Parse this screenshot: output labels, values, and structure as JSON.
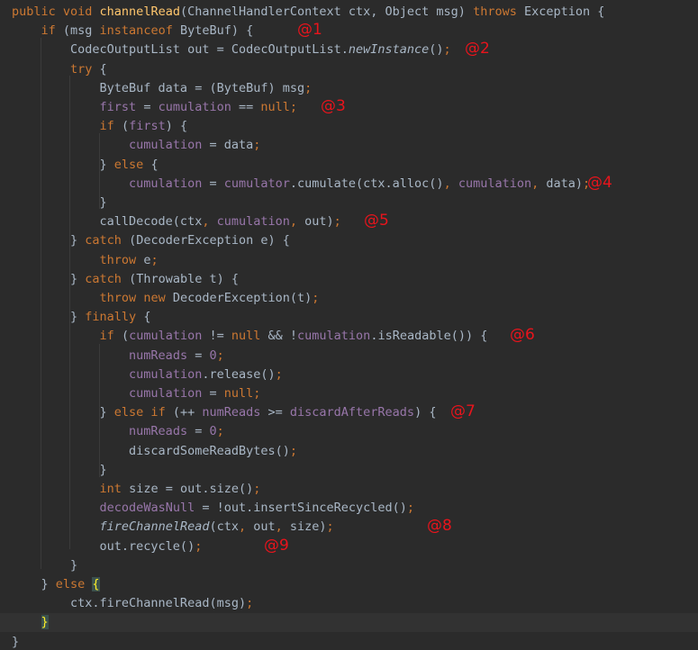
{
  "editor": {
    "lines": [
      [
        {
          "t": "public void ",
          "c": "kw"
        },
        {
          "t": "channelRead",
          "c": "fn"
        },
        {
          "t": "(ChannelHandlerContext ctx, Object msg) "
        },
        {
          "t": "throws ",
          "c": "kw"
        },
        {
          "t": "Exception {"
        }
      ],
      [
        {
          "t": "    "
        },
        {
          "t": "if ",
          "c": "kw"
        },
        {
          "t": "(msg "
        },
        {
          "t": "instanceof ",
          "c": "kw"
        },
        {
          "t": "ByteBuf) {"
        }
      ],
      [
        {
          "t": "        CodecOutputList out = CodecOutputList."
        },
        {
          "t": "newInstance",
          "c": "ital"
        },
        {
          "t": "()"
        },
        {
          "t": ";",
          "c": "kw"
        }
      ],
      [
        {
          "t": "        "
        },
        {
          "t": "try ",
          "c": "kw"
        },
        {
          "t": "{"
        }
      ],
      [
        {
          "t": "            ByteBuf data = (ByteBuf) msg"
        },
        {
          "t": ";",
          "c": "kw"
        }
      ],
      [
        {
          "t": "            "
        },
        {
          "t": "first",
          "c": "fld"
        },
        {
          "t": " = "
        },
        {
          "t": "cumulation",
          "c": "fld"
        },
        {
          "t": " == "
        },
        {
          "t": "null",
          "c": "kw"
        },
        {
          "t": ";",
          "c": "kw"
        }
      ],
      [
        {
          "t": "            "
        },
        {
          "t": "if ",
          "c": "kw"
        },
        {
          "t": "("
        },
        {
          "t": "first",
          "c": "fld"
        },
        {
          "t": ") {"
        }
      ],
      [
        {
          "t": "                "
        },
        {
          "t": "cumulation",
          "c": "fld"
        },
        {
          "t": " = data"
        },
        {
          "t": ";",
          "c": "kw"
        }
      ],
      [
        {
          "t": "            } "
        },
        {
          "t": "else ",
          "c": "kw"
        },
        {
          "t": "{"
        }
      ],
      [
        {
          "t": "                "
        },
        {
          "t": "cumulation",
          "c": "fld"
        },
        {
          "t": " = "
        },
        {
          "t": "cumulator",
          "c": "fld"
        },
        {
          "t": ".cumulate(ctx.alloc()"
        },
        {
          "t": ", ",
          "c": "kw"
        },
        {
          "t": "cumulation",
          "c": "fld"
        },
        {
          "t": ", ",
          "c": "kw"
        },
        {
          "t": "data)"
        },
        {
          "t": ";",
          "c": "kw"
        }
      ],
      [
        {
          "t": "            }"
        }
      ],
      [
        {
          "t": "            callDecode(ctx"
        },
        {
          "t": ", ",
          "c": "kw"
        },
        {
          "t": "cumulation",
          "c": "fld"
        },
        {
          "t": ", ",
          "c": "kw"
        },
        {
          "t": "out)"
        },
        {
          "t": ";",
          "c": "kw"
        }
      ],
      [
        {
          "t": "        } "
        },
        {
          "t": "catch ",
          "c": "kw"
        },
        {
          "t": "(DecoderException e) {"
        }
      ],
      [
        {
          "t": "            "
        },
        {
          "t": "throw ",
          "c": "kw"
        },
        {
          "t": "e"
        },
        {
          "t": ";",
          "c": "kw"
        }
      ],
      [
        {
          "t": "        } "
        },
        {
          "t": "catch ",
          "c": "kw"
        },
        {
          "t": "(Throwable t) {"
        }
      ],
      [
        {
          "t": "            "
        },
        {
          "t": "throw new ",
          "c": "kw"
        },
        {
          "t": "DecoderException(t)"
        },
        {
          "t": ";",
          "c": "kw"
        }
      ],
      [
        {
          "t": "        } "
        },
        {
          "t": "finally ",
          "c": "kw"
        },
        {
          "t": "{"
        }
      ],
      [
        {
          "t": "            "
        },
        {
          "t": "if ",
          "c": "kw"
        },
        {
          "t": "("
        },
        {
          "t": "cumulation",
          "c": "fld"
        },
        {
          "t": " != "
        },
        {
          "t": "null ",
          "c": "kw"
        },
        {
          "t": "&& !"
        },
        {
          "t": "cumulation",
          "c": "fld"
        },
        {
          "t": ".isReadable()) {"
        }
      ],
      [
        {
          "t": "                "
        },
        {
          "t": "numReads",
          "c": "fld"
        },
        {
          "t": " = "
        },
        {
          "t": "0",
          "c": "fld"
        },
        {
          "t": ";",
          "c": "kw"
        }
      ],
      [
        {
          "t": "                "
        },
        {
          "t": "cumulation",
          "c": "fld"
        },
        {
          "t": ".release()"
        },
        {
          "t": ";",
          "c": "kw"
        }
      ],
      [
        {
          "t": "                "
        },
        {
          "t": "cumulation",
          "c": "fld"
        },
        {
          "t": " = "
        },
        {
          "t": "null",
          "c": "kw"
        },
        {
          "t": ";",
          "c": "kw"
        }
      ],
      [
        {
          "t": "            } "
        },
        {
          "t": "else if ",
          "c": "kw"
        },
        {
          "t": "(++ "
        },
        {
          "t": "numReads",
          "c": "fld"
        },
        {
          "t": " >= "
        },
        {
          "t": "discardAfterReads",
          "c": "fld"
        },
        {
          "t": ") {"
        }
      ],
      [
        {
          "t": "                "
        },
        {
          "t": "numReads",
          "c": "fld"
        },
        {
          "t": " = "
        },
        {
          "t": "0",
          "c": "fld"
        },
        {
          "t": ";",
          "c": "kw"
        }
      ],
      [
        {
          "t": "                discardSomeReadBytes()"
        },
        {
          "t": ";",
          "c": "kw"
        }
      ],
      [
        {
          "t": "            }"
        }
      ],
      [
        {
          "t": "            "
        },
        {
          "t": "int ",
          "c": "kw"
        },
        {
          "t": "size = out.size()"
        },
        {
          "t": ";",
          "c": "kw"
        }
      ],
      [
        {
          "t": "            "
        },
        {
          "t": "decodeWasNull",
          "c": "fld"
        },
        {
          "t": " = !out.insertSinceRecycled()"
        },
        {
          "t": ";",
          "c": "kw"
        }
      ],
      [
        {
          "t": "            "
        },
        {
          "t": "fireChannelRead",
          "c": "ital"
        },
        {
          "t": "(ctx"
        },
        {
          "t": ", ",
          "c": "kw"
        },
        {
          "t": "out"
        },
        {
          "t": ", ",
          "c": "kw"
        },
        {
          "t": "size)"
        },
        {
          "t": ";",
          "c": "kw"
        }
      ],
      [
        {
          "t": "            out.recycle()"
        },
        {
          "t": ";",
          "c": "kw"
        }
      ],
      [
        {
          "t": "        }"
        }
      ],
      [
        {
          "t": "    } "
        },
        {
          "t": "else ",
          "c": "kw"
        },
        {
          "t": "{",
          "c": "brace-hl"
        }
      ],
      [
        {
          "t": "        ctx.fireChannelRead(msg)"
        },
        {
          "t": ";",
          "c": "kw"
        }
      ],
      [
        {
          "t": "    "
        },
        {
          "t": "}",
          "c": "brace-hl"
        }
      ],
      [
        {
          "t": "}"
        }
      ]
    ],
    "current_line": 32,
    "annotations": [
      {
        "label": "@1",
        "line": 1
      },
      {
        "label": "@2",
        "line": 2
      },
      {
        "label": "@3",
        "line": 5
      },
      {
        "label": "@4",
        "line": 9
      },
      {
        "label": "@5",
        "line": 11
      },
      {
        "label": "@6",
        "line": 17
      },
      {
        "label": "@7",
        "line": 21
      },
      {
        "label": "@8",
        "line": 27
      },
      {
        "label": "@9",
        "line": 28
      }
    ]
  }
}
